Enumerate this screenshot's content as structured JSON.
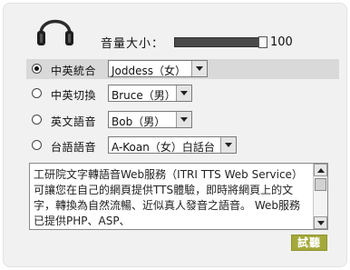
{
  "volume": {
    "label": "音量大小：",
    "value": "100",
    "level_percent": 100
  },
  "voices": [
    {
      "label": "中英統合",
      "selected": true,
      "option": "Joddess（女）"
    },
    {
      "label": "中英切換",
      "selected": false,
      "option": "Bruce（男）"
    },
    {
      "label": "英文語音",
      "selected": false,
      "option": "Bob（男）"
    },
    {
      "label": "台語語音",
      "selected": false,
      "option": "A-Koan（女）白話台"
    }
  ],
  "text_input": {
    "value": "工研院文字轉語音Web服務（ITRI TTS Web Service）可讓您在自己的網頁提供TTS體驗，即時將網頁上的文字，轉換為自然流暢、近似真人發音之語音。 Web服務已提供PHP、ASP、"
  },
  "try_button": {
    "label": "試聽"
  },
  "colors": {
    "accent": "#a4a93a",
    "panel": "#f1f1f1",
    "selected_row": "#d9d9d9"
  },
  "icons": {
    "logo": "headphones-icon"
  }
}
